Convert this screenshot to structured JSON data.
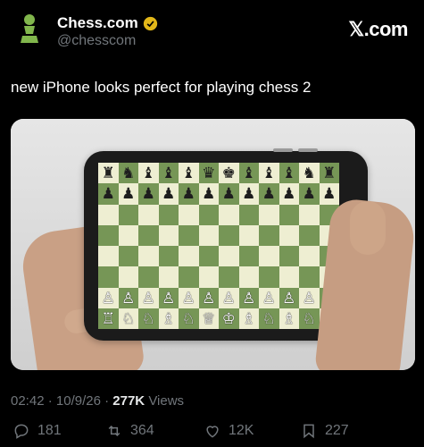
{
  "header": {
    "display_name": "Chess.com",
    "handle": "@chesscom",
    "watermark": "𝕏.com",
    "verified_icon": "verified-badge-icon",
    "avatar_icon": "pawn-icon"
  },
  "tweet": {
    "text": "new iPhone looks perfect for playing chess 2"
  },
  "board": {
    "cols": 12,
    "rows": 8,
    "pieces": [
      [
        "♜",
        "♞",
        "♝",
        "♝",
        "♝",
        "♛",
        "♚",
        "♝",
        "♝",
        "♝",
        "♞",
        "♜"
      ],
      [
        "♟",
        "♟",
        "♟",
        "♟",
        "♟",
        "♟",
        "♟",
        "♟",
        "♟",
        "♟",
        "♟",
        "♟"
      ],
      [
        "",
        "",
        "",
        "",
        "",
        "",
        "",
        "",
        "",
        "",
        "",
        ""
      ],
      [
        "",
        "",
        "",
        "",
        "",
        "",
        "",
        "",
        "",
        "",
        "",
        ""
      ],
      [
        "",
        "",
        "",
        "",
        "",
        "",
        "",
        "",
        "",
        "",
        "",
        ""
      ],
      [
        "",
        "",
        "",
        "",
        "",
        "",
        "",
        "",
        "",
        "",
        "",
        ""
      ],
      [
        "♙",
        "♙",
        "♙",
        "♙",
        "♙",
        "♙",
        "♙",
        "♙",
        "♙",
        "♙",
        "♙",
        "♙"
      ],
      [
        "♖",
        "♘",
        "♘",
        "♗",
        "♘",
        "♕",
        "♔",
        "♗",
        "♘",
        "♗",
        "♘",
        "♖"
      ]
    ],
    "colors": {
      "light": "#eeeed2",
      "dark": "#769656"
    }
  },
  "meta": {
    "time": "02:42",
    "date": "10/9/26",
    "views_count": "277K",
    "views_label": "Views"
  },
  "actions": {
    "replies": "181",
    "reposts": "364",
    "likes": "12K",
    "bookmarks": "227"
  }
}
